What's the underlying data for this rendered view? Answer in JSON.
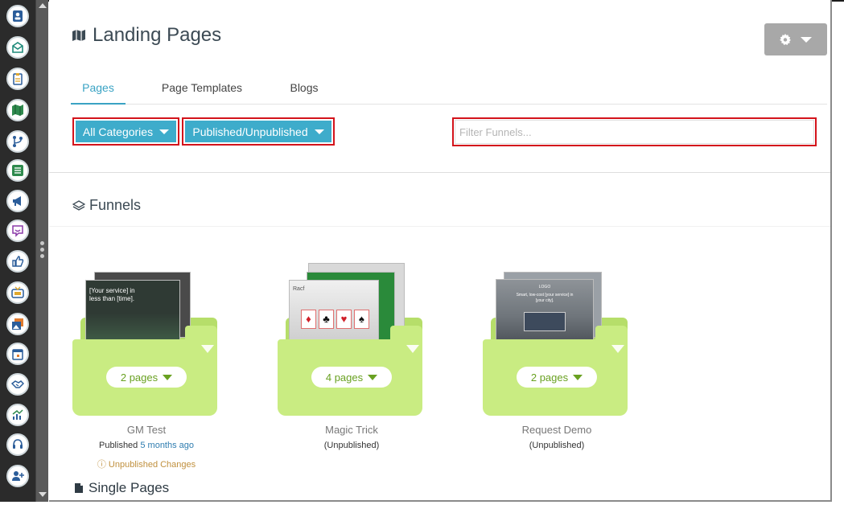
{
  "page": {
    "title": "Landing Pages"
  },
  "tabs": [
    {
      "label": "Pages",
      "active": true
    },
    {
      "label": "Page Templates",
      "active": false
    },
    {
      "label": "Blogs",
      "active": false
    }
  ],
  "filters": {
    "categories_label": "All Categories",
    "publish_label": "Published/Unpublished",
    "search_placeholder": "Filter Funnels..."
  },
  "sections": {
    "funnels": "Funnels",
    "single_pages": "Single Pages"
  },
  "funnels": [
    {
      "name": "GM Test",
      "pages": "2 pages",
      "status_prefix": "Published ",
      "status_ago": "5 months ago",
      "warning": "Unpublished Changes"
    },
    {
      "name": "Magic Trick",
      "pages": "4 pages",
      "status_prefix": "(Unpublished)",
      "status_ago": "",
      "warning": ""
    },
    {
      "name": "Request Demo",
      "pages": "2 pages",
      "status_prefix": "(Unpublished)",
      "status_ago": "",
      "warning": ""
    }
  ],
  "thumb_text": {
    "gm_line1": "[Your service] in",
    "gm_line2": "less than [time].",
    "magic_text": "Racf",
    "demo_logo": "LOGO",
    "demo_line1": "Smart, low-cost [your service] in",
    "demo_line2": "[your city]."
  },
  "sidebar_icons": [
    "contacts-icon",
    "email-icon",
    "clipboard-icon",
    "map-icon",
    "branch-icon",
    "list-icon",
    "megaphone-icon",
    "chat-icon",
    "thumbs-up-icon",
    "tv-icon",
    "images-icon",
    "calendar-icon",
    "handshake-icon",
    "analytics-icon",
    "support-icon",
    "add-user-icon"
  ],
  "colors": {
    "accent": "#3aa3c4",
    "filter_btn": "#3eaccb",
    "highlight": "#d3131b",
    "folder": "#c9ec82",
    "pill_text": "#69a121"
  }
}
